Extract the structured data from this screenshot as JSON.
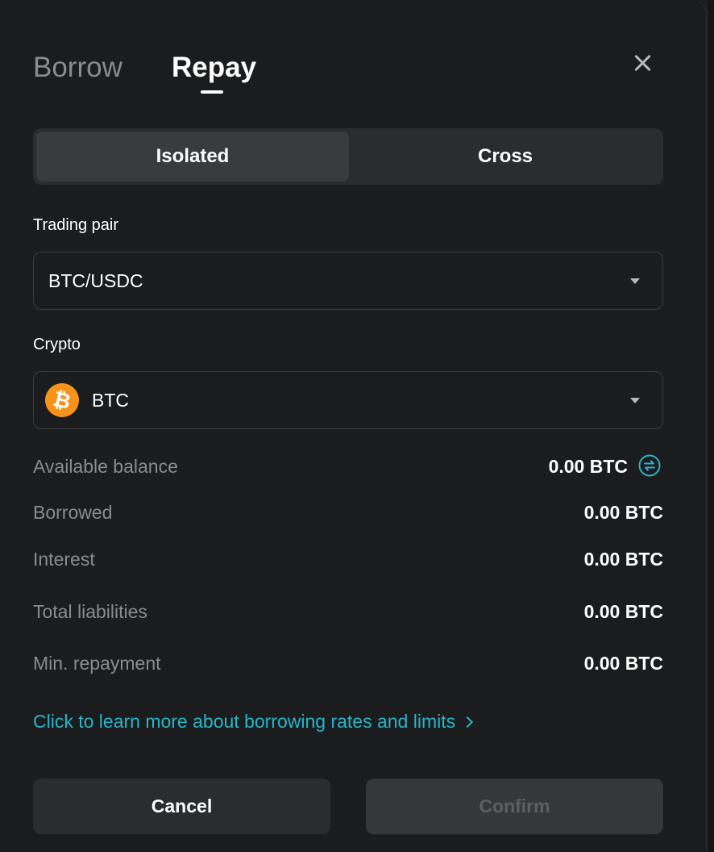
{
  "tabs": {
    "borrow": "Borrow",
    "repay": "Repay",
    "active": "Repay"
  },
  "mode": {
    "isolated": "Isolated",
    "cross": "Cross",
    "selected": "Isolated"
  },
  "trading_pair": {
    "label": "Trading pair",
    "value": "BTC/USDC"
  },
  "crypto": {
    "label": "Crypto",
    "value": "BTC",
    "icon": "bitcoin-icon",
    "icon_glyph": "₿",
    "icon_color": "#f7931a"
  },
  "details": {
    "available_balance": {
      "label": "Available balance",
      "value": "0.00 BTC"
    },
    "borrowed": {
      "label": "Borrowed",
      "value": "0.00 BTC"
    },
    "interest": {
      "label": "Interest",
      "value": "0.00 BTC"
    },
    "total_liabilities": {
      "label": "Total liabilities",
      "value": "0.00 BTC"
    },
    "min_repayment": {
      "label": "Min. repayment",
      "value": "0.00 BTC"
    }
  },
  "learn_more": {
    "text": "Click to learn more about borrowing rates and limits"
  },
  "actions": {
    "cancel": "Cancel",
    "confirm": "Confirm"
  },
  "colors": {
    "background": "#1b1c1e",
    "accent": "#27b5c8",
    "muted_text": "#8a8b8e"
  }
}
